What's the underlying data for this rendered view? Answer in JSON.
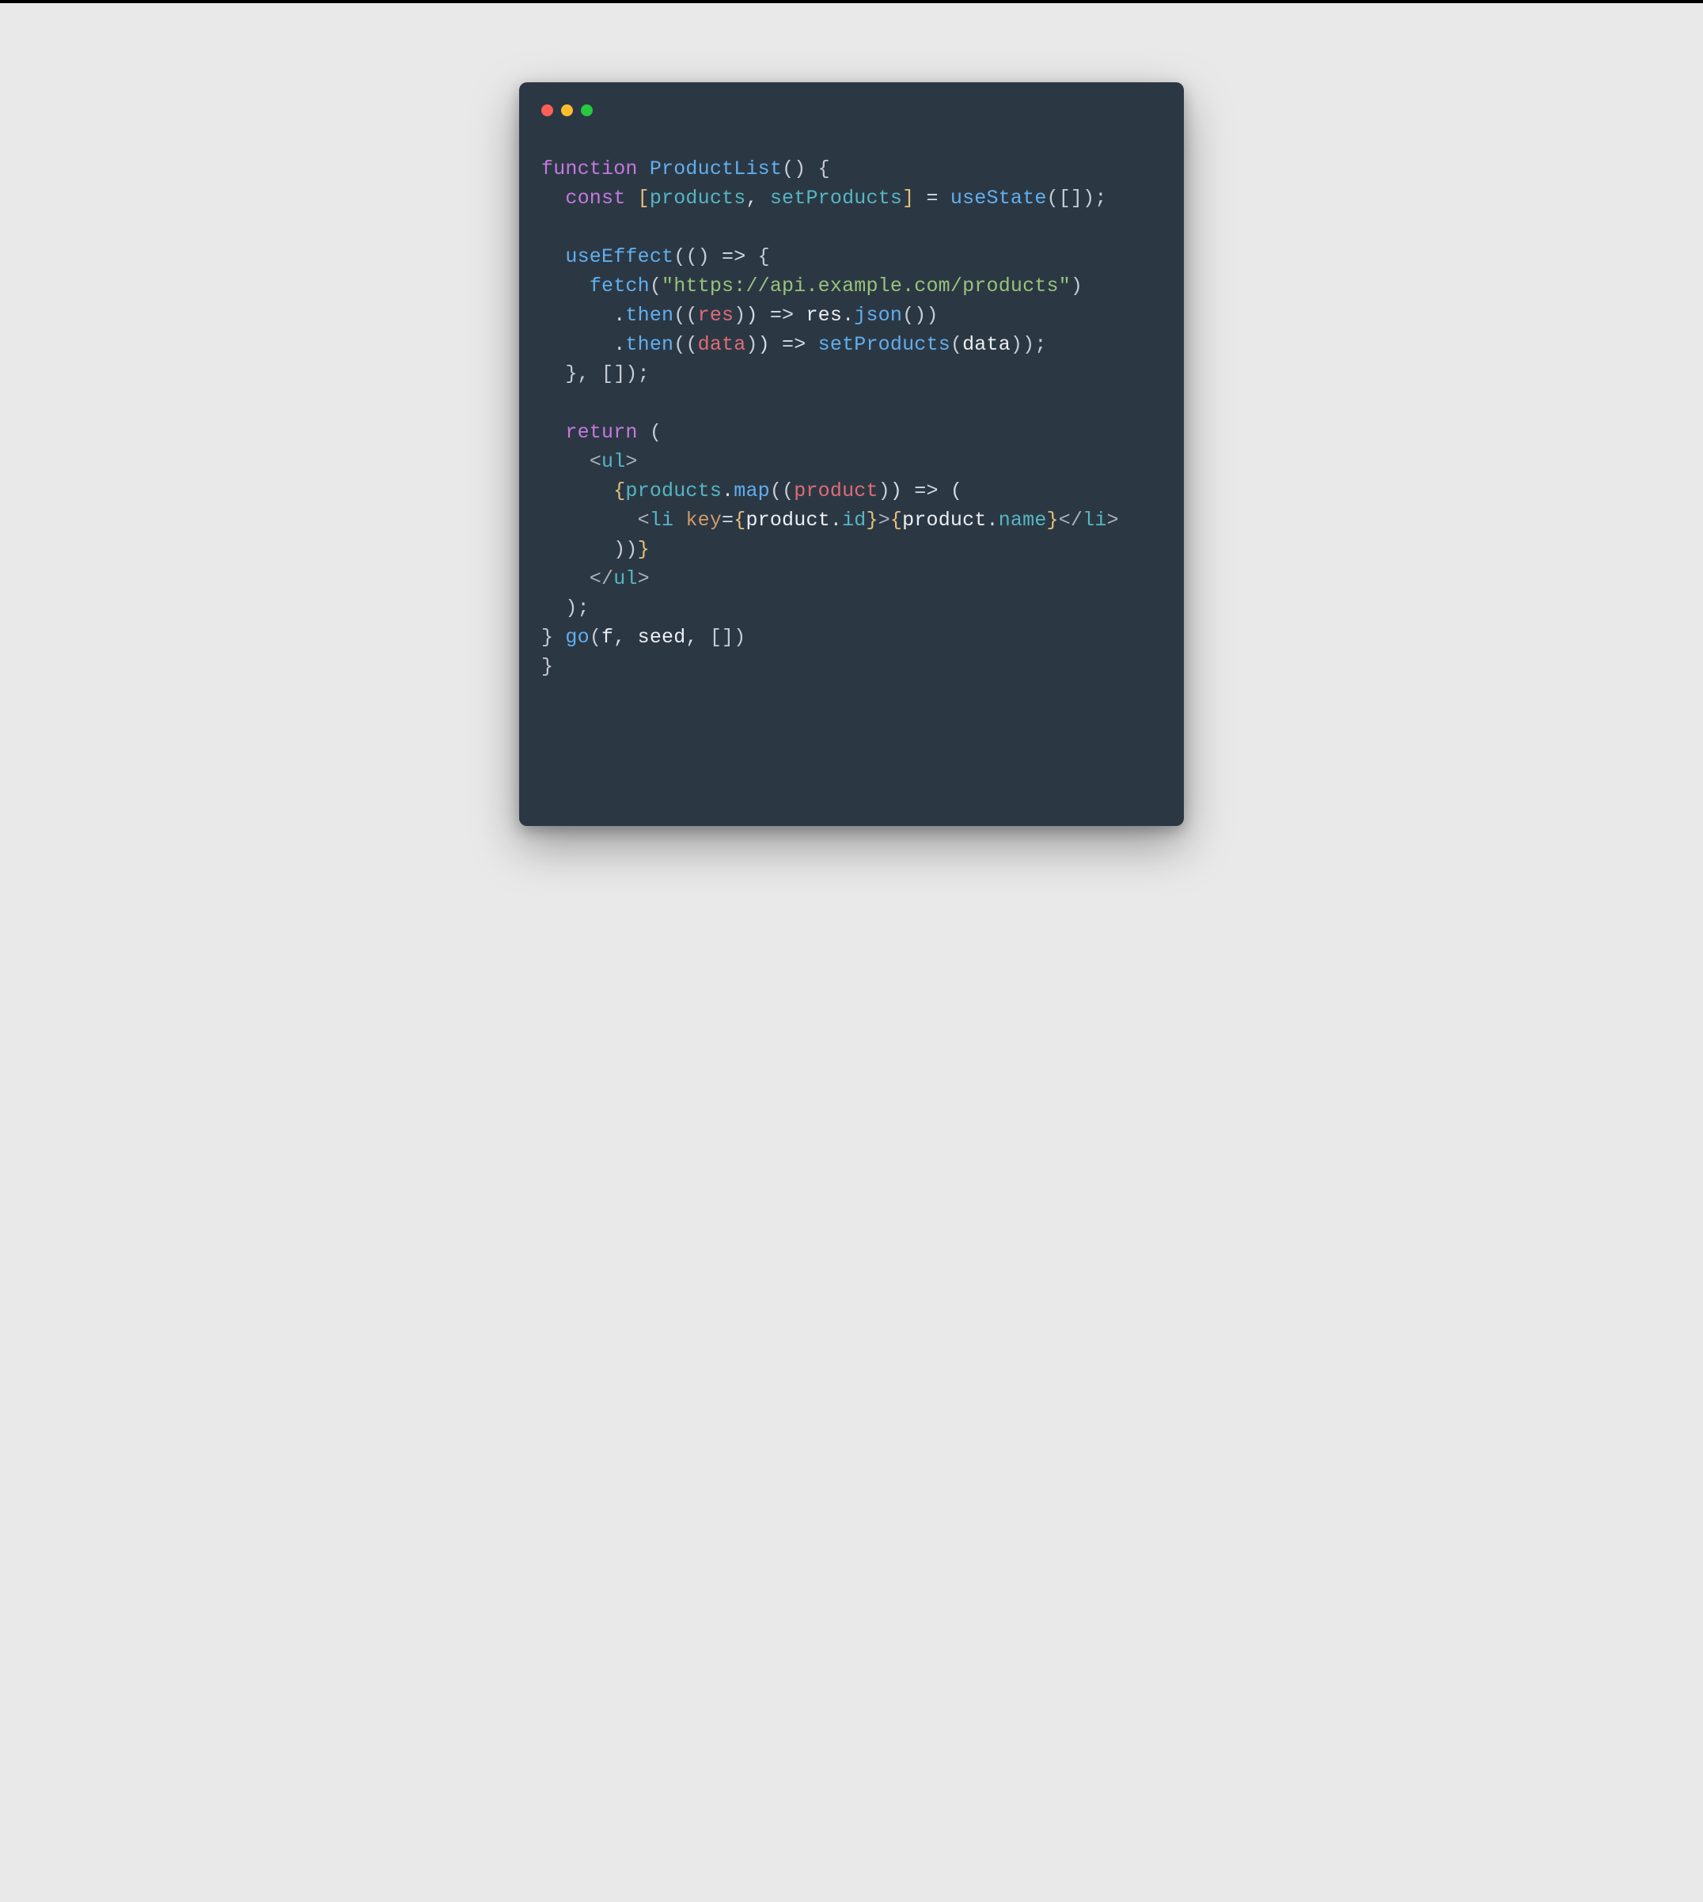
{
  "colors": {
    "bg": "#e9e9e9",
    "frame": "#2b3844",
    "red": "#ff5f56",
    "yellow": "#ffbd2e",
    "green": "#27c93f",
    "keyword": "#c678dd",
    "fn": "#61afef",
    "string": "#98c379",
    "prop": "#56b6c2",
    "attr": "#d19a66",
    "gold": "#e5c07b",
    "param": "#e06c75",
    "text": "#d5dbe3"
  },
  "code": {
    "l1": {
      "kw_function": "function",
      "fn_name": "ProductList",
      "pp": "()",
      "brace": " {"
    },
    "l2": {
      "indent": "  ",
      "kw_const": "const",
      "sp": " ",
      "lb": "[",
      "id1": "products",
      "comma": ",",
      "sp2": " ",
      "id2": "setProducts",
      "rb": "]",
      "eq": " = ",
      "call": "useState",
      "args": "([]);"
    },
    "l3": "",
    "l4": {
      "indent": "  ",
      "call": "useEffect",
      "open": "((",
      "arg_empty": "",
      "close_arrow": ") => {",
      "lp1": "(",
      "rp1": ")",
      "arrow": " => ",
      "brace": "{"
    },
    "l5": {
      "indent": "    ",
      "call": "fetch",
      "lp": "(",
      "str": "\"https://api.example.com/products\"",
      "rp": ")"
    },
    "l6": {
      "indent": "      ",
      "dot": ".",
      "then": "then",
      "lp": "((",
      "param": "res",
      "rp_arrow": ") => ",
      "obj": "res",
      "dot2": ".",
      "meth": "json",
      "tail": "())",
      "lp1": "(",
      "lp2": "(",
      "rp1": ")",
      "rp2": "())"
    },
    "l7": {
      "indent": "      ",
      "dot": ".",
      "then": "then",
      "lp": "((",
      "param": "data",
      "rp_arrow": ") => ",
      "call": "setProducts",
      "lp2": "(",
      "arg": "data",
      "rp2": "));",
      "lp1": "(",
      "rp1": ")"
    },
    "l8": {
      "indent": "  ",
      "text": "}, []);"
    },
    "l9": "",
    "l10": {
      "indent": "  ",
      "kw_return": "return",
      "open": " ("
    },
    "l11": {
      "indent": "    ",
      "lt": "<",
      "tag": "ul",
      "gt": ">"
    },
    "l12": {
      "indent": "      ",
      "lbrace": "{",
      "obj": "products",
      "dot": ".",
      "map": "map",
      "lp": "((",
      "param": "product",
      "rp_arrow": ") => (",
      "lp1": "(",
      "lp2": "(",
      "rp1": ")"
    },
    "l13": {
      "indent": "        ",
      "lt": "<",
      "tag": "li",
      "sp": " ",
      "attr": "key",
      "eq": "=",
      "lbrace": "{",
      "obj": "product",
      "dot": ".",
      "prop": "id",
      "rbrace": "}",
      "gt": ">",
      "lbrace2": "{",
      "obj2": "product",
      "dot2": ".",
      "prop2": "name",
      "rbrace2": "}",
      "ltc": "</",
      "tagc": "li",
      "gtc": ">"
    },
    "l14": {
      "indent": "      ",
      "text": "))",
      "rbrace": "}"
    },
    "l15": {
      "indent": "    ",
      "ltc": "</",
      "tag": "ul",
      "gt": ">"
    },
    "l16": {
      "indent": "  ",
      "text": ");"
    },
    "l17": {
      "brace": "}",
      "sp": " ",
      "call": "go",
      "lp": "(",
      "a1": "f",
      "c1": ", ",
      "a2": "seed",
      "c2": ", ",
      "a3": "[]",
      "rp": ")"
    },
    "l18": {
      "brace": "}"
    }
  }
}
